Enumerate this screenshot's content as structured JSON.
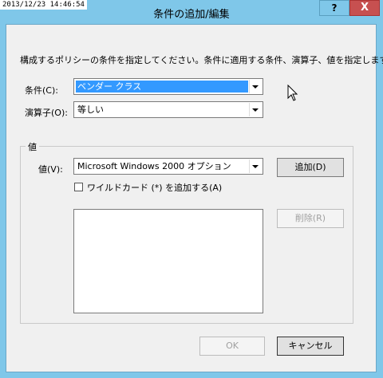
{
  "timestamp": "2013/12/23 14:46:54",
  "window": {
    "title": "条件の追加/編集",
    "help_label": "?",
    "close_label": "X"
  },
  "instruction": "構成するポリシーの条件を指定してください。条件に適用する条件、演算子、値を指定します。",
  "condition": {
    "label": "条件(C):",
    "value": "ベンダー クラス"
  },
  "operator": {
    "label": "演算子(O):",
    "value": "等しい"
  },
  "value_group": {
    "title": "値",
    "value_label": "値(V):",
    "value": "Microsoft Windows 2000 オプション",
    "add_button": "追加(D)",
    "wildcard_checkbox_label": "ワイルドカード (*) を追加する(A)",
    "wildcard_checked": false,
    "delete_button": "削除(R)",
    "list_items": []
  },
  "footer": {
    "ok_button": "OK",
    "cancel_button": "キャンセル"
  },
  "colors": {
    "titlebar": "#7fc7e9",
    "close": "#c75050",
    "selection": "#3399ff"
  }
}
